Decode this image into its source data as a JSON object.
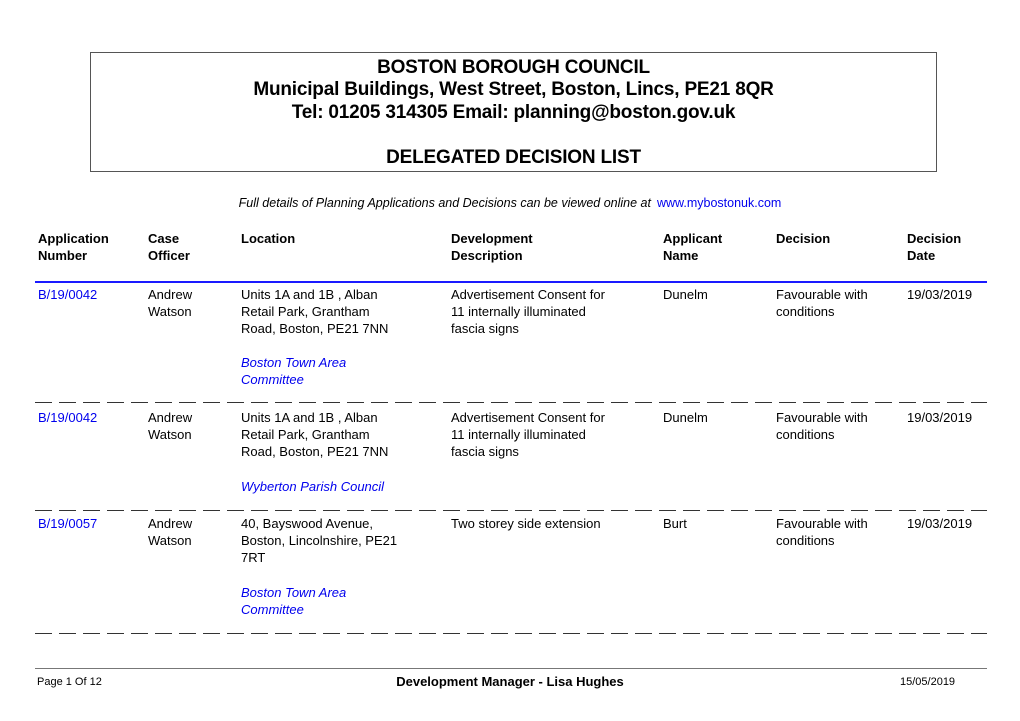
{
  "header": {
    "org": "BOSTON BOROUGH COUNCIL",
    "address": "Municipal Buildings, West Street, Boston, Lincs, PE21 8QR",
    "contact": "Tel: 01205 314305  Email: planning@boston.gov.uk",
    "title": "DELEGATED DECISION LIST"
  },
  "note": {
    "text": "Full details of Planning Applications and Decisions can be viewed online at",
    "link": "www.mybostonuk.com"
  },
  "columns": [
    {
      "line1": "Application",
      "line2": "Number"
    },
    {
      "line1": "Case",
      "line2": "Officer"
    },
    {
      "line1": "Location",
      "line2": ""
    },
    {
      "line1": "Development",
      "line2": "Description"
    },
    {
      "line1": "Applicant",
      "line2": "Name"
    },
    {
      "line1": "Decision",
      "line2": ""
    },
    {
      "line1": "Decision",
      "line2": "Date"
    }
  ],
  "rows": [
    {
      "app_no": "B/19/0042",
      "officer": [
        "Andrew",
        "Watson"
      ],
      "location": [
        "Units 1A and 1B , Alban",
        "Retail Park, Grantham",
        "Road, Boston, PE21 7NN"
      ],
      "committee": [
        "Boston Town Area",
        "Committee"
      ],
      "description": [
        "Advertisement Consent for",
        "11 internally illuminated",
        "fascia signs"
      ],
      "applicant": "Dunelm",
      "decision": [
        "Favourable with",
        "conditions"
      ],
      "date": "19/03/2019"
    },
    {
      "app_no": "B/19/0042",
      "officer": [
        "Andrew",
        "Watson"
      ],
      "location": [
        "Units 1A and 1B , Alban",
        "Retail Park, Grantham",
        "Road, Boston, PE21 7NN"
      ],
      "committee": [
        "Wyberton Parish Council",
        ""
      ],
      "description": [
        "Advertisement Consent for",
        "11 internally illuminated",
        "fascia signs"
      ],
      "applicant": "Dunelm",
      "decision": [
        "Favourable with",
        "conditions"
      ],
      "date": "19/03/2019"
    },
    {
      "app_no": "B/19/0057",
      "officer": [
        "Andrew",
        "Watson"
      ],
      "location": [
        "40, Bayswood Avenue,",
        "Boston, Lincolnshire, PE21",
        "7RT"
      ],
      "committee": [
        "Boston Town Area",
        "Committee"
      ],
      "description": [
        "Two storey side extension",
        "",
        ""
      ],
      "applicant": "Burt",
      "decision": [
        "Favourable with",
        "conditions"
      ],
      "date": "19/03/2019"
    }
  ],
  "footer": {
    "page": "Page 1 Of 12",
    "manager": "Development Manager - Lisa Hughes",
    "date": "15/05/2019"
  }
}
